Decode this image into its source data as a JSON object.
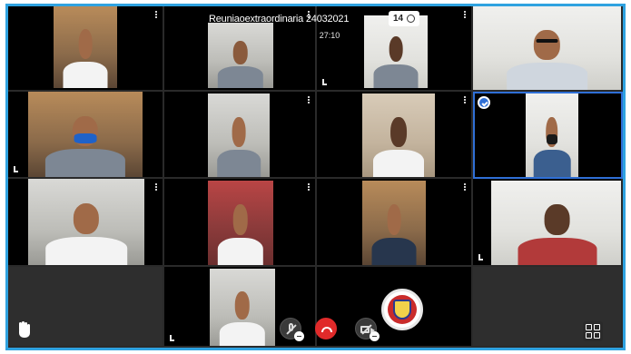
{
  "meeting": {
    "title": "Reuniaoextraordinaria 24032021",
    "participant_count": "14",
    "duration": "27:10",
    "participants_icon": "people-icon"
  },
  "tiles": [
    {
      "id": "p1",
      "kind": "video"
    },
    {
      "id": "p2",
      "kind": "video"
    },
    {
      "id": "p3",
      "kind": "video"
    },
    {
      "id": "p4",
      "kind": "video"
    },
    {
      "id": "p5",
      "kind": "video",
      "mask": true
    },
    {
      "id": "p6",
      "kind": "video"
    },
    {
      "id": "p7",
      "kind": "video"
    },
    {
      "id": "p8",
      "kind": "video",
      "selected": true,
      "mask": true
    },
    {
      "id": "p9",
      "kind": "video"
    },
    {
      "id": "p10",
      "kind": "video"
    },
    {
      "id": "p11",
      "kind": "video"
    },
    {
      "id": "p12",
      "kind": "video"
    },
    {
      "id": "p13",
      "kind": "empty"
    },
    {
      "id": "p14",
      "kind": "video"
    },
    {
      "id": "p15",
      "kind": "emblem"
    },
    {
      "id": "p16",
      "kind": "empty"
    }
  ],
  "controls": {
    "raise_hand_icon": "hand-icon",
    "mic_icon": "microphone-off-icon",
    "hangup_icon": "phone-hangup-icon",
    "camera_icon": "camera-off-icon",
    "layout_icon": "grid-layout-icon"
  },
  "colors": {
    "frame_border": "#2fa2e0",
    "hangup": "#e02a2a",
    "selected": "#2f6fd6"
  }
}
